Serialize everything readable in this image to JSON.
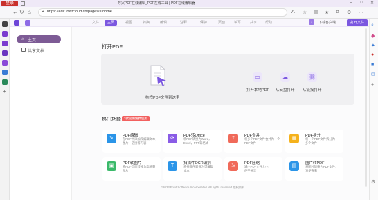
{
  "titlebar": {
    "avatar": "登录",
    "title": "万兴PDF在线编辑_PDF在线工具 | PDF在线编辑器"
  },
  "addressbar": {
    "url": "https://edit.foxitcloud.cn/pages/#/home"
  },
  "app": {
    "menus": [
      "文件",
      "主页",
      "视图",
      "转换",
      "编辑",
      "注释",
      "保护",
      "页面",
      "填写",
      "共享",
      "帮助"
    ],
    "active_menu": "主页",
    "download_label": "下载客户端",
    "open_button": "打开文件"
  },
  "sidebar": {
    "items": [
      {
        "label": "主页",
        "icon": "home-icon"
      },
      {
        "label": "共享文档",
        "icon": "shared-doc-icon"
      }
    ]
  },
  "open_pdf": {
    "title": "打开PDF",
    "drop_label": "拖拽PDF文件到这里",
    "actions": [
      {
        "label": "打开本地PDF",
        "icon": "monitor-icon"
      },
      {
        "label": "从云盘打开",
        "icon": "cloud-icon"
      },
      {
        "label": "从链接打开",
        "icon": "link-icon"
      }
    ]
  },
  "hot": {
    "title": "热门功能",
    "badge": "3款提供免费使用",
    "features": [
      {
        "title": "PDF编辑",
        "desc": [
          "在PDF中添加和编辑文本，",
          "图片，链接等内容"
        ],
        "color": "#2b95e8",
        "icon": "edit-doc-icon"
      },
      {
        "title": "PDF转Office",
        "desc": [
          "将PDF转换为Word，",
          "Excel，PPT等格式"
        ],
        "color": "#8a5ce6",
        "icon": "convert-icon"
      },
      {
        "title": "PDF合并",
        "desc": [
          "将多个PDF文件合并为一个",
          "PDF文件"
        ],
        "color": "#f06a5a",
        "icon": "merge-icon"
      },
      {
        "title": "PDF拆分",
        "desc": [
          "将一个PDF文件拆分为",
          "多个文件"
        ],
        "color": "#f5b21c",
        "icon": "split-icon"
      },
      {
        "title": "PDF转图片",
        "desc": [
          "将PDF页面转换为高质量",
          "图片"
        ],
        "color": "#3bb96a",
        "icon": "image-icon"
      },
      {
        "title": "扫描件OCR识别",
        "desc": [
          "将扫描件转换为可编辑",
          "文本"
        ],
        "color": "#2b95e8",
        "icon": "ocr-icon"
      },
      {
        "title": "PDF压缩",
        "desc": [
          "减小PDF文件大小，",
          "便于分享"
        ],
        "color": "#f06a5a",
        "icon": "compress-icon"
      },
      {
        "title": "图片转PDF",
        "desc": [
          "将图片转换为PDF文件，",
          "方便查看"
        ],
        "color": "#2b95e8",
        "icon": "img2pdf-icon"
      }
    ]
  },
  "footer": "©2023 Foxit Software Incorporated. All rights reserved 版权所有"
}
